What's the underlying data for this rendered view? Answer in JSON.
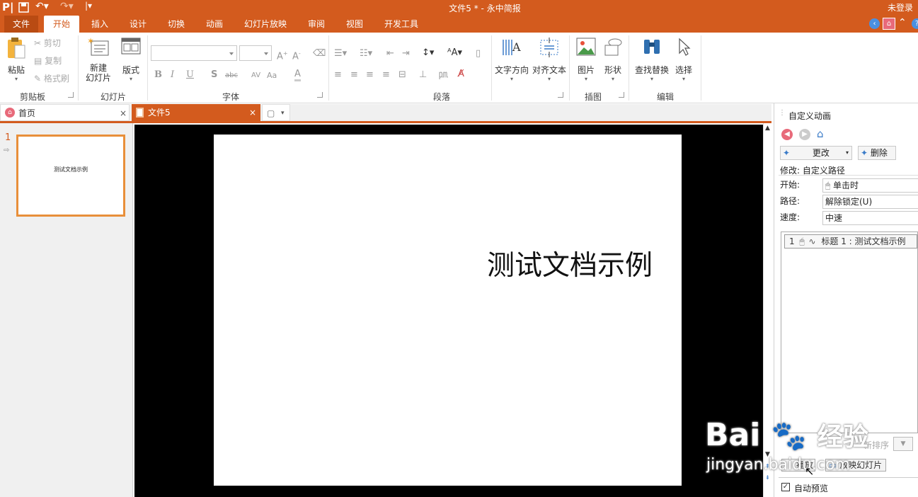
{
  "titlebar": {
    "title": "文件5 * - 永中简报",
    "user": "未登录"
  },
  "menu": [
    {
      "label": "文件"
    },
    {
      "label": "开始"
    },
    {
      "label": "插入"
    },
    {
      "label": "设计"
    },
    {
      "label": "切换"
    },
    {
      "label": "动画"
    },
    {
      "label": "幻灯片放映"
    },
    {
      "label": "审阅"
    },
    {
      "label": "视图"
    },
    {
      "label": "开发工具"
    }
  ],
  "ribbon": {
    "clipboard": {
      "paste": "粘贴",
      "cut": "剪切",
      "copy": "复制",
      "format_painter": "格式刷",
      "label": "剪贴板"
    },
    "slides": {
      "new_slide_line1": "新建",
      "new_slide_line2": "幻灯片",
      "layout": "版式",
      "label": "幻灯片"
    },
    "font": {
      "label": "字体",
      "bold": "B",
      "italic": "I",
      "underline": "U",
      "shadow": "S",
      "strike": "abc",
      "spacing": "AV",
      "case": "Aa",
      "color": "A"
    },
    "paragraph": {
      "label": "段落"
    },
    "text_direction": "文字方向",
    "align_text": "对齐文本",
    "drawing": {
      "picture": "图片",
      "shape": "形状",
      "label": "插图"
    },
    "editing": {
      "find_replace": "查找替换",
      "select": "选择",
      "label": "编辑"
    }
  },
  "tabs": {
    "home": "首页",
    "doc": "文件5"
  },
  "slides_panel": {
    "number": "1",
    "thumb_text": "测试文档示例"
  },
  "slide": {
    "title": "测试文档示例"
  },
  "custom_animation": {
    "title": "自定义动画",
    "change": "更改",
    "delete": "删除",
    "modify_label": "修改: 自定义路径",
    "start_label": "开始:",
    "start_value": "单击时",
    "path_label": "路径:",
    "path_value": "解除锁定(U)",
    "speed_label": "速度:",
    "speed_value": "中速",
    "list_item": {
      "index": "1",
      "text": "标题 1 : 测试文档示例"
    },
    "reorder": "新排序",
    "play": "播放",
    "slideshow": "放映幻灯片",
    "auto_preview": "自动预览"
  },
  "watermark": {
    "brand": "Bai",
    "brand_cn": "经验",
    "url": "jingyan.baidu.com"
  },
  "colors": {
    "accent": "#d35b1e",
    "thumb_border": "#e88f3a"
  }
}
